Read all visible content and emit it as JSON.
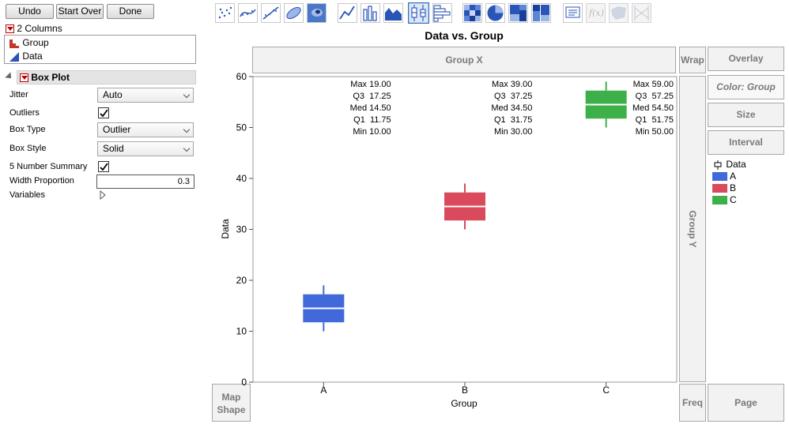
{
  "toolbar": {
    "undo": "Undo",
    "start_over": "Start Over",
    "done": "Done"
  },
  "columns": {
    "header": "2 Columns",
    "items": [
      {
        "label": "Group",
        "icon": "nominal-bar-icon"
      },
      {
        "label": "Data",
        "icon": "continuous-triangle-icon"
      }
    ]
  },
  "boxplot_panel": {
    "title": "Box Plot",
    "jitter_label": "Jitter",
    "jitter_value": "Auto",
    "outliers_label": "Outliers",
    "outliers_checked": true,
    "box_type_label": "Box Type",
    "box_type_value": "Outlier",
    "box_style_label": "Box Style",
    "box_style_value": "Solid",
    "five_number_label": "5 Number Summary",
    "five_number_checked": true,
    "width_label": "Width Proportion",
    "width_value": "0.3",
    "variables_label": "Variables"
  },
  "graph": {
    "title": "Data vs. Group",
    "group_x": "Group X",
    "group_y": "Group Y",
    "wrap": "Wrap",
    "overlay": "Overlay",
    "color": "Color: Group",
    "size": "Size",
    "interval": "Interval",
    "map_shape_line1": "Map",
    "map_shape_line2": "Shape",
    "freq": "Freq",
    "page": "Page"
  },
  "legend": {
    "title": "Data",
    "items": [
      {
        "label": "A",
        "color": "#4169d9"
      },
      {
        "label": "B",
        "color": "#d94a5c"
      },
      {
        "label": "C",
        "color": "#3db04a"
      }
    ]
  },
  "chart_data": {
    "type": "box",
    "title": "Data vs. Group",
    "xlabel": "Group",
    "ylabel": "Data",
    "ylim": [
      0,
      60
    ],
    "yticks": [
      "0",
      "10",
      "20",
      "30",
      "40",
      "50",
      "60"
    ],
    "categories": [
      "A",
      "B",
      "C"
    ],
    "colors": [
      "#4169d9",
      "#d94a5c",
      "#3db04a"
    ],
    "boxes": [
      {
        "min": 10,
        "q1": 11.75,
        "med": 14.5,
        "q3": 17.25,
        "max": 19
      },
      {
        "min": 30,
        "q1": 31.75,
        "med": 34.5,
        "q3": 37.25,
        "max": 39
      },
      {
        "min": 50,
        "q1": 51.75,
        "med": 54.5,
        "q3": 57.25,
        "max": 59
      }
    ],
    "summaries": [
      {
        "max": "Max 19.00",
        "q3": "Q3  17.25",
        "med": "Med 14.50",
        "q1": "Q1  11.75",
        "min": "Min 10.00"
      },
      {
        "max": "Max 39.00",
        "q3": "Q3  37.25",
        "med": "Med 34.50",
        "q1": "Q1  31.75",
        "min": "Min 30.00"
      },
      {
        "max": "Max 59.00",
        "q3": "Q3  57.25",
        "med": "Med 54.50",
        "q1": "Q1  51.75",
        "min": "Min 50.00"
      }
    ]
  }
}
